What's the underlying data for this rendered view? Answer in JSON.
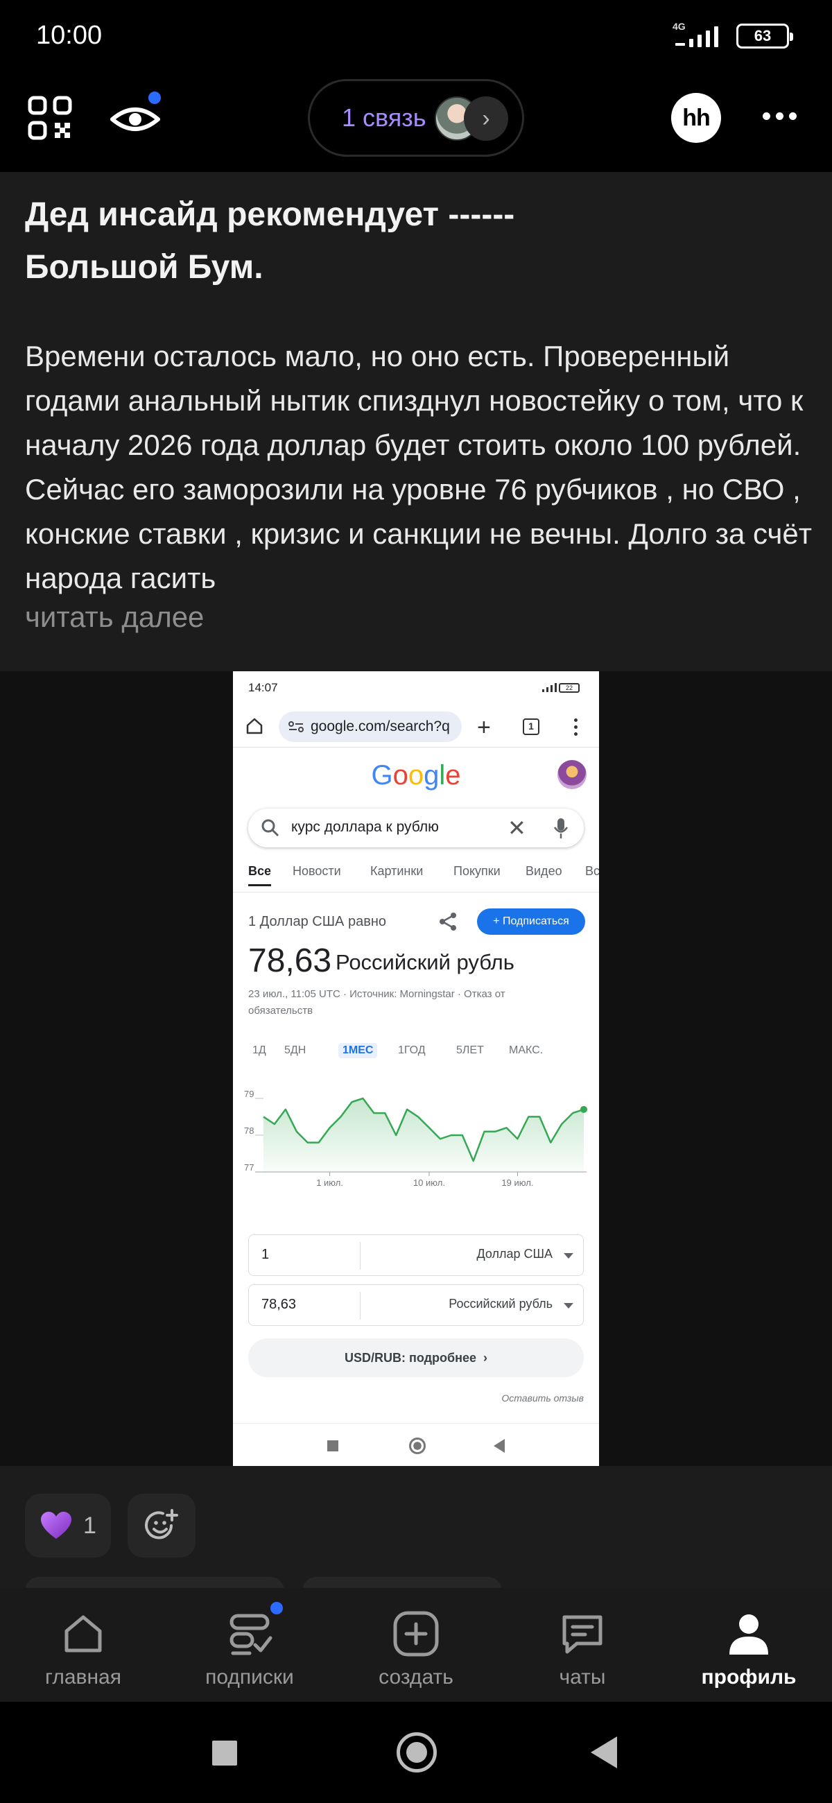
{
  "status": {
    "time": "10:00",
    "network": "4G",
    "battery": "63"
  },
  "header": {
    "connect_label": "1 связь",
    "logo_text": "hh"
  },
  "post": {
    "title": "Дед инсайд рекомендует ------\nБольшой Бум.",
    "body": "Времени осталось мало, но оно есть. Проверенный годами анальный нытик спизднул новостейку о том, что к началу 2026 года доллар будет стоить около 100 рублей. Сейчас его заморозили на уровне 76 рубчиков , но СВО , конские ставки , кризис и санкции не вечны. Долго за счёт народа гасить",
    "read_more": "читать далее"
  },
  "screenshot": {
    "time": "14:07",
    "battery": "22",
    "url": "google.com/search?q",
    "tabs_count": "1",
    "google_logo": "Google",
    "query": "курс доллара к рублю",
    "tabs": [
      "Все",
      "Новости",
      "Картинки",
      "Покупки",
      "Видео",
      "Вс"
    ],
    "equals_text": "1 Доллар США равно",
    "subscribe_label": "+ Подписаться",
    "rate_value": "78,63",
    "rate_unit": "Российский рубль",
    "source_text": "23 июл., 11:05 UTC · Источник: Morningstar · Отказ от обязательств",
    "ranges": [
      "1Д",
      "5ДН",
      "1МЕС",
      "1ГОД",
      "5ЛЕТ",
      "МАКС."
    ],
    "active_range": "1МЕС",
    "from_amount": "1",
    "from_currency": "Доллар США",
    "to_amount": "78,63",
    "to_currency": "Российский рубль",
    "more_label": "USD/RUB: подробнее",
    "feedback_label": "Оставить отзыв"
  },
  "chart_data": {
    "type": "area",
    "ylim": [
      77,
      79.3
    ],
    "y_ticks": [
      "79",
      "78",
      "77"
    ],
    "x_tick_labels": [
      "1 июл.",
      "10 июл.",
      "19 июл."
    ],
    "values": [
      78.5,
      78.3,
      78.7,
      78.1,
      77.8,
      77.8,
      78.2,
      78.5,
      78.9,
      79.0,
      78.6,
      78.6,
      78.0,
      78.7,
      78.5,
      78.2,
      77.9,
      78.0,
      78.0,
      77.3,
      78.1,
      78.1,
      78.2,
      77.9,
      78.5,
      78.5,
      77.8,
      78.3,
      78.6,
      78.7
    ],
    "x_tick_indices": [
      6,
      15,
      23
    ],
    "color": "#34a853",
    "grid": false
  },
  "reactions": {
    "like_emoji": "💜",
    "like_count": "1"
  },
  "nav": {
    "items": [
      {
        "label": "главная",
        "icon": "home-icon"
      },
      {
        "label": "подписки",
        "icon": "subscriptions-icon"
      },
      {
        "label": "создать",
        "icon": "create-icon"
      },
      {
        "label": "чаты",
        "icon": "chat-icon"
      },
      {
        "label": "профиль",
        "icon": "profile-icon"
      }
    ],
    "active": "профиль"
  }
}
